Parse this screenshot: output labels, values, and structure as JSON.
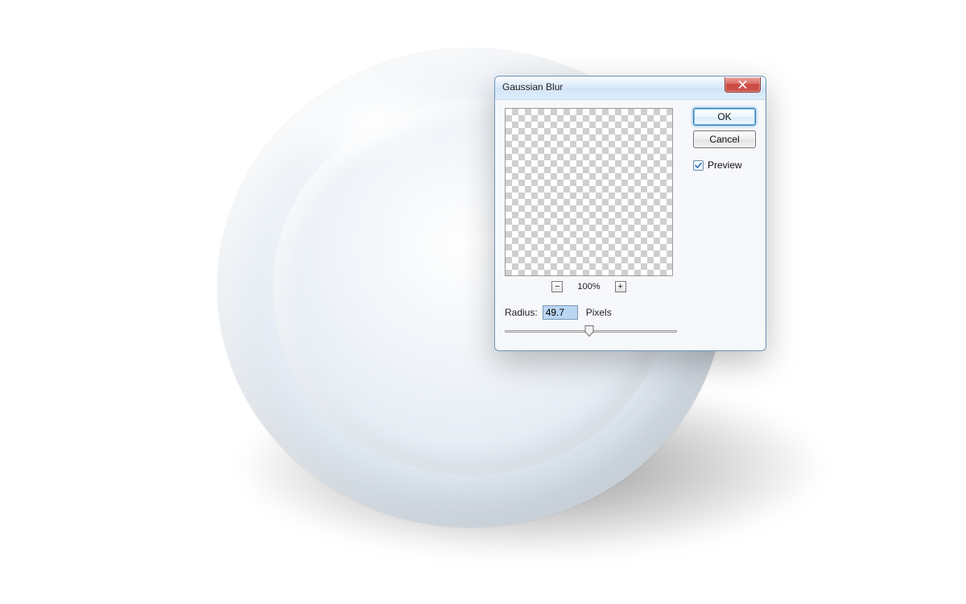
{
  "dialog": {
    "title": "Gaussian Blur",
    "ok_label": "OK",
    "cancel_label": "Cancel",
    "preview_check_label": "Preview",
    "preview_checked": true,
    "zoom": {
      "minus_label": "−",
      "plus_label": "+",
      "percent_text": "100%"
    },
    "radius": {
      "label": "Radius:",
      "value_text": "49.7",
      "units_label": "Pixels",
      "slider_fraction": 0.49
    }
  }
}
